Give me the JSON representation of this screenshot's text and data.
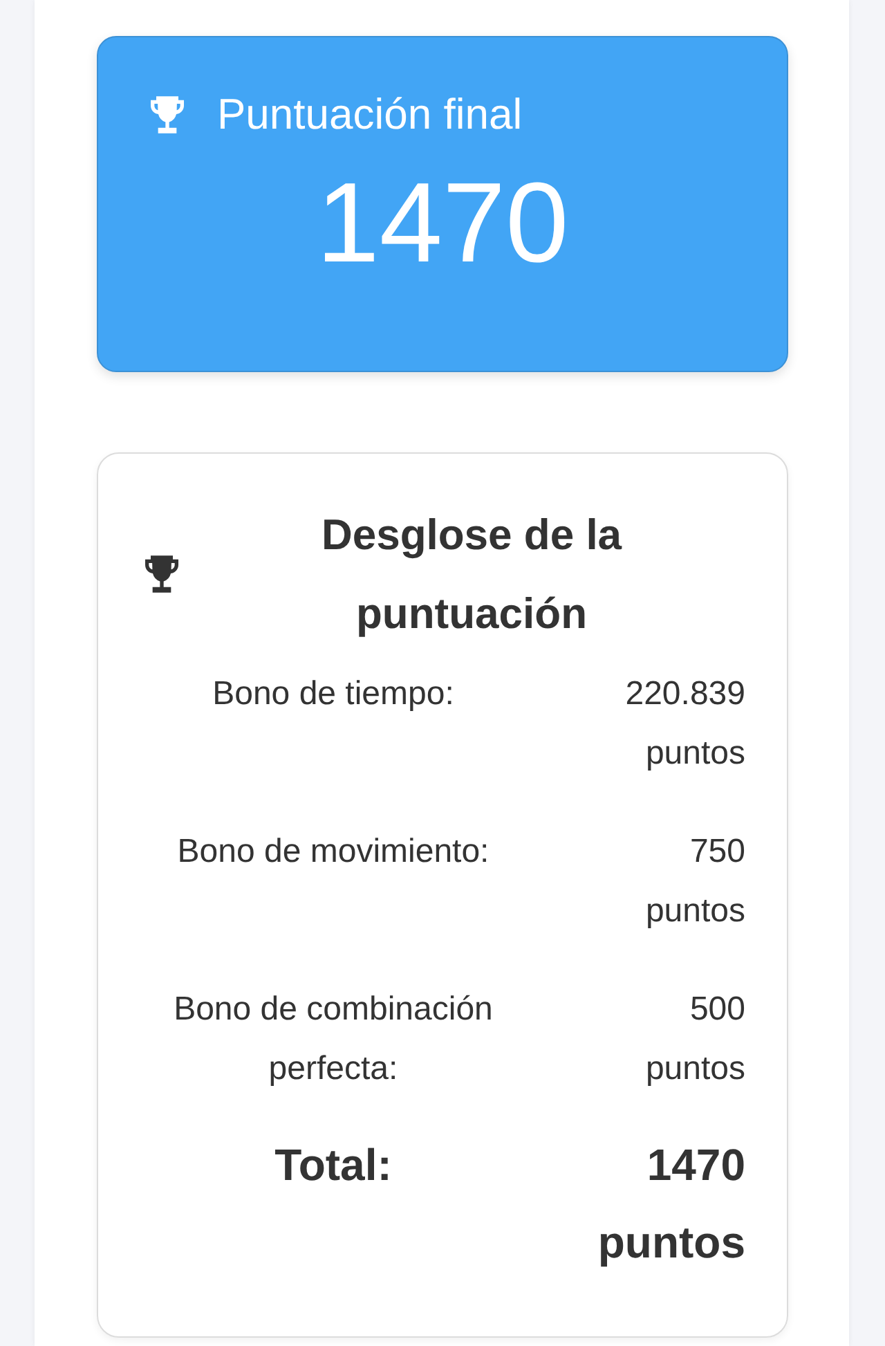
{
  "score_card": {
    "title": "Puntuación final",
    "score": "1470"
  },
  "breakdown": {
    "title": "Desglose de la puntuación",
    "rows": [
      {
        "kind": "bonus",
        "label": "Bono de tiempo:",
        "value": "220.839 puntos"
      },
      {
        "kind": "bonus",
        "label": "Bono de movimiento:",
        "value": "750 puntos"
      },
      {
        "kind": "bonus",
        "label": "Bono de combinación perfecta:",
        "value": "500 puntos"
      },
      {
        "kind": "total",
        "label": "Total:",
        "value": "1470 puntos"
      }
    ]
  }
}
